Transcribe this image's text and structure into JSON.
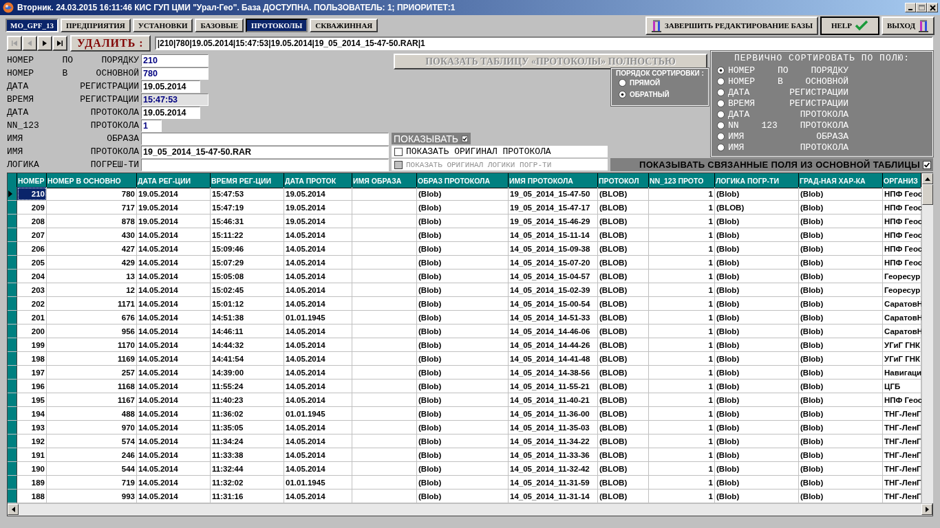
{
  "window": {
    "title": "Вторник. 24.03.2015 16:11:46 КИС ГУП ЦМИ \"Урал-Гео\". База ДОСТУПНА. ПОЛЬЗОВАТЕЛЬ: 1; ПРИОРИТЕТ:1"
  },
  "database_label": "MO_GPF_13",
  "tabs": [
    {
      "label": "ПРЕДПРИЯТИЯ",
      "selected": false
    },
    {
      "label": "УСТАНОВКИ",
      "selected": false
    },
    {
      "label": "БАЗОВЫЕ",
      "selected": false
    },
    {
      "label": "ПРОТОКОЛЫ",
      "selected": true
    },
    {
      "label": "СКВАЖИННАЯ",
      "selected": false
    }
  ],
  "toolbar_buttons": [
    {
      "label": "ЗАВЕРШИТЬ РЕДАКТИРОВАНИЕ БАЗЫ",
      "kind": "finish"
    },
    {
      "label": "HELP",
      "kind": "help"
    },
    {
      "label": "ВЫХОД",
      "kind": "exit"
    }
  ],
  "navigator": {
    "buttons": [
      {
        "kind": "first",
        "disabled": true
      },
      {
        "kind": "prev",
        "disabled": true
      },
      {
        "kind": "next",
        "disabled": false
      },
      {
        "kind": "last",
        "disabled": false
      }
    ],
    "delete_label": "УДАЛИТЬ :",
    "record": "|210|780|19.05.2014|15:47:53|19.05.2014|19_05_2014_15-47-50.RAR|1"
  },
  "fields": [
    {
      "label": "НОМЕР ПО ПОРЯДКУ",
      "value": "210",
      "kind": "number"
    },
    {
      "label": "НОМЕР В ОСНОВНОЙ",
      "value": "780",
      "kind": "number"
    },
    {
      "label": "ДАТА РЕГИСТРАЦИИ",
      "value": "19.05.2014",
      "kind": "date"
    },
    {
      "label": "ВРЕМЯ РЕГИСТРАЦИИ",
      "value": "15:47:53",
      "kind": "time"
    },
    {
      "label": "ДАТА ПРОТОКОЛА",
      "value": "19.05.2014",
      "kind": "date"
    },
    {
      "label": "NN_123 ПРОТОКОЛА",
      "value": "1",
      "kind": "counter"
    },
    {
      "label": "ИМЯ ОБРАЗА",
      "kind": "text"
    },
    {
      "label": "ИМЯ ПРОТОКОЛА",
      "value": "19_05_2014_15-47-50.RAR",
      "kind": "text"
    },
    {
      "label": "ЛОГИКА ПОГРЕШ-ТИ",
      "kind": "text"
    }
  ],
  "show_full_button": {
    "label": "ПОКАЗАТЬ ТАБЛИЦУ «ПРОТОКОЛЫ» ПОЛНОСТЬЮ",
    "disabled": true
  },
  "sort_order": {
    "title": "ПОРЯДОК СОРТИРОВКИ :",
    "options": [
      {
        "label": "ПРЯМОЙ",
        "selected": false
      },
      {
        "label": "ОБРАТНЫЙ",
        "selected": true
      }
    ]
  },
  "primary_sort": {
    "title": "ПЕРВИЧНО СОРТИРОВАТЬ ПО ПОЛЮ:",
    "options": [
      {
        "label": "НОМЕР ПО ПОРЯДКУ",
        "selected": true
      },
      {
        "label": "НОМЕР В ОСНОВНОЙ",
        "selected": false
      },
      {
        "label": "ДАТА РЕГИСТРАЦИИ",
        "selected": false
      },
      {
        "label": "ВРЕМЯ РЕГИСТРАЦИИ",
        "selected": false
      },
      {
        "label": "ДАТА ПРОТОКОЛА",
        "selected": false
      },
      {
        "label": "NN 123 ПРОТОКОЛА",
        "selected": false
      },
      {
        "label": "ИМЯ ОБРАЗА",
        "selected": false
      },
      {
        "label": "ИМЯ ПРОТОКОЛА",
        "selected": false
      }
    ]
  },
  "checkboxes": [
    {
      "label": "ПОКАЗЫВАТЬ",
      "checked": true,
      "disabled": false,
      "kind": "banner"
    },
    {
      "label": "ПОКАЗАТЬ ОРИГИНАЛ ПРОТОКОЛА",
      "checked": false,
      "disabled": false,
      "kind": "plain"
    },
    {
      "label": "ПОКАЗАТЬ ОРИГИНАЛ ЛОГИКИ ПОГР-ТИ",
      "checked": false,
      "disabled": true,
      "kind": "plain"
    }
  ],
  "linked_fields_checkbox": {
    "label": "ПОКАЗЫВАТЬ СВЯЗАННЫЕ ПОЛЯ ИЗ ОСНОВНОЙ ТАБЛИЦЫ",
    "checked": true
  },
  "table": {
    "columns": [
      {
        "label": "НОМЕР",
        "kind": "number"
      },
      {
        "label": "НОМЕР В ОСНОВНО",
        "kind": "number"
      },
      {
        "label": "ДАТА РЕГ-ЦИИ",
        "kind": "text"
      },
      {
        "label": "ВРЕМЯ РЕГ-ЦИИ",
        "kind": "text"
      },
      {
        "label": "ДАТА ПРОТОК",
        "kind": "text"
      },
      {
        "label": "ИМЯ ОБРАЗА",
        "kind": "text"
      },
      {
        "label": "ОБРАЗ ПРОТОКОЛА",
        "kind": "text"
      },
      {
        "label": "ИМЯ ПРОТОКОЛА",
        "kind": "text"
      },
      {
        "label": "ПРОТОКОЛ",
        "kind": "text"
      },
      {
        "label": "NN_123 ПРОТО",
        "kind": "number"
      },
      {
        "label": "ЛОГИКА ПОГР-ТИ",
        "kind": "text"
      },
      {
        "label": "ГРАД-НАЯ ХАР-КА",
        "kind": "text"
      },
      {
        "label": "ОРГАНИЗ",
        "kind": "text"
      }
    ],
    "rows": [
      {
        "selected": true,
        "cells": [
          "210",
          "780",
          "19.05.2014",
          "15:47:53",
          "19.05.2014",
          null,
          "(Blob)",
          "19_05_2014_15-47-50",
          "(BLOB)",
          "1",
          "(Blob)",
          "(Blob)",
          "НПФ Геос"
        ]
      },
      {
        "selected": false,
        "cells": [
          "209",
          "717",
          "19.05.2014",
          "15:47:19",
          "19.05.2014",
          null,
          "(Blob)",
          "19_05_2014_15-47-17",
          "(BLOB)",
          "1",
          "(BLOB)",
          "(Blob)",
          "НПФ Геос"
        ]
      },
      {
        "selected": false,
        "cells": [
          "208",
          "878",
          "19.05.2014",
          "15:46:31",
          "19.05.2014",
          null,
          "(Blob)",
          "19_05_2014_15-46-29",
          "(BLOB)",
          "1",
          "(Blob)",
          "(Blob)",
          "НПФ Геос"
        ]
      },
      {
        "selected": false,
        "cells": [
          "207",
          "430",
          "14.05.2014",
          "15:11:22",
          "14.05.2014",
          null,
          "(Blob)",
          "14_05_2014_15-11-14",
          "(BLOB)",
          "1",
          "(Blob)",
          "(Blob)",
          "НПФ Геос"
        ]
      },
      {
        "selected": false,
        "cells": [
          "206",
          "427",
          "14.05.2014",
          "15:09:46",
          "14.05.2014",
          null,
          "(Blob)",
          "14_05_2014_15-09-38",
          "(BLOB)",
          "1",
          "(Blob)",
          "(Blob)",
          "НПФ Геос"
        ]
      },
      {
        "selected": false,
        "cells": [
          "205",
          "429",
          "14.05.2014",
          "15:07:29",
          "14.05.2014",
          null,
          "(Blob)",
          "14_05_2014_15-07-20",
          "(BLOB)",
          "1",
          "(Blob)",
          "(Blob)",
          "НПФ Геос"
        ]
      },
      {
        "selected": false,
        "cells": [
          "204",
          "13",
          "14.05.2014",
          "15:05:08",
          "14.05.2014",
          null,
          "(Blob)",
          "14_05_2014_15-04-57",
          "(BLOB)",
          "1",
          "(Blob)",
          "(Blob)",
          "Георесур"
        ]
      },
      {
        "selected": false,
        "cells": [
          "203",
          "12",
          "14.05.2014",
          "15:02:45",
          "14.05.2014",
          null,
          "(Blob)",
          "14_05_2014_15-02-39",
          "(BLOB)",
          "1",
          "(Blob)",
          "(Blob)",
          "Георесур"
        ]
      },
      {
        "selected": false,
        "cells": [
          "202",
          "1171",
          "14.05.2014",
          "15:01:12",
          "14.05.2014",
          null,
          "(Blob)",
          "14_05_2014_15-00-54",
          "(BLOB)",
          "1",
          "(Blob)",
          "(Blob)",
          "СаратовН"
        ]
      },
      {
        "selected": false,
        "cells": [
          "201",
          "676",
          "14.05.2014",
          "14:51:38",
          "01.01.1945",
          null,
          "(Blob)",
          "14_05_2014_14-51-33",
          "(BLOB)",
          "1",
          "(Blob)",
          "(Blob)",
          "СаратовН"
        ]
      },
      {
        "selected": false,
        "cells": [
          "200",
          "956",
          "14.05.2014",
          "14:46:11",
          "14.05.2014",
          null,
          "(Blob)",
          "14_05_2014_14-46-06",
          "(BLOB)",
          "1",
          "(Blob)",
          "(Blob)",
          "СаратовН"
        ]
      },
      {
        "selected": false,
        "cells": [
          "199",
          "1170",
          "14.05.2014",
          "14:44:32",
          "14.05.2014",
          null,
          "(Blob)",
          "14_05_2014_14-44-26",
          "(BLOB)",
          "1",
          "(Blob)",
          "(Blob)",
          "УГиГ ГНК"
        ]
      },
      {
        "selected": false,
        "cells": [
          "198",
          "1169",
          "14.05.2014",
          "14:41:54",
          "14.05.2014",
          null,
          "(Blob)",
          "14_05_2014_14-41-48",
          "(BLOB)",
          "1",
          "(Blob)",
          "(Blob)",
          "УГиГ ГНК"
        ]
      },
      {
        "selected": false,
        "cells": [
          "197",
          "257",
          "14.05.2014",
          "14:39:00",
          "14.05.2014",
          null,
          "(Blob)",
          "14_05_2014_14-38-56",
          "(BLOB)",
          "1",
          "(Blob)",
          "(Blob)",
          "Навигаци"
        ]
      },
      {
        "selected": false,
        "cells": [
          "196",
          "1168",
          "14.05.2014",
          "11:55:24",
          "14.05.2014",
          null,
          "(Blob)",
          "14_05_2014_11-55-21",
          "(BLOB)",
          "1",
          "(Blob)",
          "(Blob)",
          "ЦГБ"
        ]
      },
      {
        "selected": false,
        "cells": [
          "195",
          "1167",
          "14.05.2014",
          "11:40:23",
          "14.05.2014",
          null,
          "(Blob)",
          "14_05_2014_11-40-21",
          "(BLOB)",
          "1",
          "(Blob)",
          "(Blob)",
          "НПФ Геос"
        ]
      },
      {
        "selected": false,
        "cells": [
          "194",
          "488",
          "14.05.2014",
          "11:36:02",
          "01.01.1945",
          null,
          "(Blob)",
          "14_05_2014_11-36-00",
          "(BLOB)",
          "1",
          "(Blob)",
          "(Blob)",
          "ТНГ-ЛенГ"
        ]
      },
      {
        "selected": false,
        "cells": [
          "193",
          "970",
          "14.05.2014",
          "11:35:05",
          "14.05.2014",
          null,
          "(Blob)",
          "14_05_2014_11-35-03",
          "(BLOB)",
          "1",
          "(Blob)",
          "(Blob)",
          "ТНГ-ЛенГ"
        ]
      },
      {
        "selected": false,
        "cells": [
          "192",
          "574",
          "14.05.2014",
          "11:34:24",
          "14.05.2014",
          null,
          "(Blob)",
          "14_05_2014_11-34-22",
          "(BLOB)",
          "1",
          "(Blob)",
          "(Blob)",
          "ТНГ-ЛенГ"
        ]
      },
      {
        "selected": false,
        "cells": [
          "191",
          "246",
          "14.05.2014",
          "11:33:38",
          "14.05.2014",
          null,
          "(Blob)",
          "14_05_2014_11-33-36",
          "(BLOB)",
          "1",
          "(Blob)",
          "(Blob)",
          "ТНГ-ЛенГ"
        ]
      },
      {
        "selected": false,
        "cells": [
          "190",
          "544",
          "14.05.2014",
          "11:32:44",
          "14.05.2014",
          null,
          "(Blob)",
          "14_05_2014_11-32-42",
          "(BLOB)",
          "1",
          "(Blob)",
          "(Blob)",
          "ТНГ-ЛенГ"
        ]
      },
      {
        "selected": false,
        "cells": [
          "189",
          "719",
          "14.05.2014",
          "11:32:02",
          "01.01.1945",
          null,
          "(Blob)",
          "14_05_2014_11-31-59",
          "(BLOB)",
          "1",
          "(Blob)",
          "(Blob)",
          "ТНГ-ЛенГ"
        ]
      },
      {
        "selected": false,
        "cells": [
          "188",
          "993",
          "14.05.2014",
          "11:31:16",
          "14.05.2014",
          null,
          "(Blob)",
          "14_05_2014_11-31-14",
          "(BLOB)",
          "1",
          "(Blob)",
          "(Blob)",
          "ТНГ-ЛенГ"
        ]
      }
    ]
  }
}
